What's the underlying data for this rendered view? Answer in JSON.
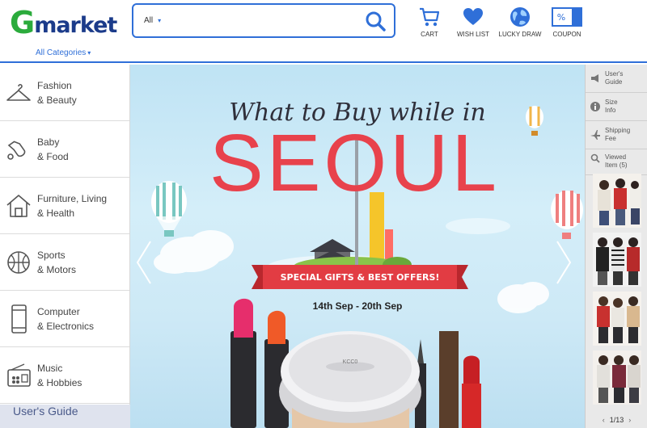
{
  "header": {
    "logo_g": "G",
    "logo_rest": "market",
    "all_categories": "All Categories",
    "search": {
      "scope": "All",
      "query": "",
      "placeholder": ""
    },
    "tools": [
      {
        "label": "CART",
        "icon": "cart-icon"
      },
      {
        "label": "WISH LIST",
        "icon": "heart-icon"
      },
      {
        "label": "LUCKY DRAW",
        "icon": "globe-icon"
      },
      {
        "label": "COUPON",
        "icon": "coupon-icon"
      }
    ],
    "accent_color": "#2f6fd8",
    "brand_green": "#2bab3c",
    "brand_navy": "#1b3b8a"
  },
  "sidebar": {
    "categories": [
      {
        "line1": "Fashion",
        "line2": "& Beauty",
        "icon": "hanger-icon"
      },
      {
        "line1": "Baby",
        "line2": "& Food",
        "icon": "rattle-icon"
      },
      {
        "line1": "Furniture, Living",
        "line2": "& Health",
        "icon": "house-icon"
      },
      {
        "line1": "Sports",
        "line2": "& Motors",
        "icon": "ball-icon"
      },
      {
        "line1": "Computer",
        "line2": "& Electronics",
        "icon": "phone-icon"
      },
      {
        "line1": "Music",
        "line2": "& Hobbies",
        "icon": "radio-icon"
      }
    ],
    "guide_label": "User's Guide"
  },
  "banner": {
    "headline": "What to Buy while in",
    "city": "SEOUL",
    "ribbon": "SPECIAL GIFTS & BEST OFFERS!",
    "dates": "14th Sep - 20th Sep",
    "accent_color": "#e23c43",
    "product_label": "KCC0"
  },
  "quick_menu": {
    "items": [
      {
        "line1": "User's",
        "line2": "Guide",
        "icon": "megaphone-icon"
      },
      {
        "line1": "Size",
        "line2": "Info",
        "icon": "info-icon"
      },
      {
        "line1": "Shipping",
        "line2": "Fee",
        "icon": "plane-icon"
      }
    ],
    "viewed_line1": "Viewed",
    "viewed_line2": "Item (5)",
    "pager": "1/13"
  }
}
